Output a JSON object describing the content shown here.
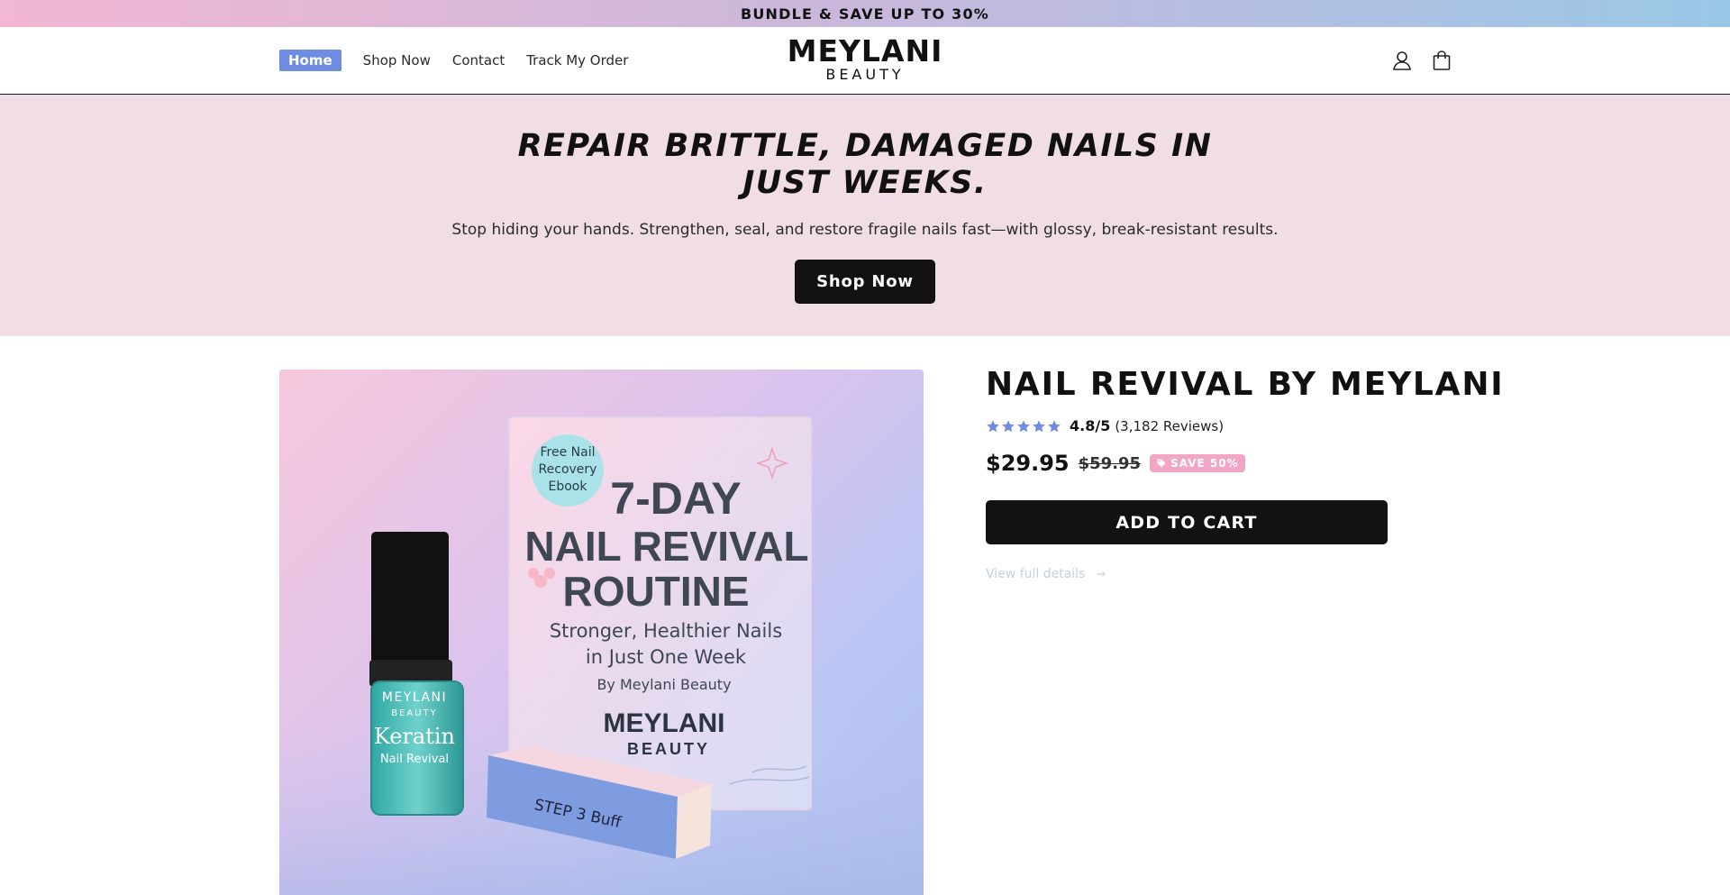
{
  "announcement": {
    "text": "BUNDLE & SAVE UP TO 30%"
  },
  "nav": {
    "items": [
      {
        "label": "Home",
        "active": true
      },
      {
        "label": "Shop Now"
      },
      {
        "label": "Contact"
      },
      {
        "label": "Track My Order"
      }
    ]
  },
  "logo": {
    "main": "MEYLANI",
    "sub": "BEAUTY"
  },
  "header_icons": {
    "account": "account-icon",
    "cart": "shopping-bag-icon"
  },
  "hero": {
    "title": "REPAIR BRITTLE, DAMAGED NAILS IN JUST WEEKS.",
    "subtitle": "Stop hiding your hands. Strengthen, seal, and restore fragile nails fast—with glossy, break-resistant results.",
    "button": "Shop Now",
    "background": "#f1dde6"
  },
  "product_image": {
    "badge": [
      "Free Nail",
      "Recovery",
      "Ebook"
    ],
    "book_title": [
      "7-DAY",
      "NAIL REVIVAL",
      "ROUTINE"
    ],
    "book_subtitle": [
      "Stronger, Healthier Nails",
      "in Just One Week"
    ],
    "book_author": "By Meylani Beauty",
    "book_brand": [
      "MEYLANI",
      "BEAUTY"
    ],
    "bottle_brand": [
      "MEYLANI",
      "BEAUTY"
    ],
    "bottle_product": [
      "Keratin",
      "Nail Revival"
    ],
    "buffer_label": "STEP 3 Buff"
  },
  "product": {
    "title": "NAIL REVIVAL BY MEYLANI",
    "rating_score": "4.8/5",
    "rating_count": "(3,182 Reviews)",
    "rating_value": 4.8,
    "price": "$29.95",
    "compare_price": "$59.95",
    "save_badge": "SAVE 50%",
    "add_to_cart": "ADD TO CART",
    "view_details": "View full details"
  },
  "colors": {
    "accent": "#6f8de0",
    "star": "#6f8de0",
    "badge": "#f2a6c6",
    "button": "#121212"
  }
}
